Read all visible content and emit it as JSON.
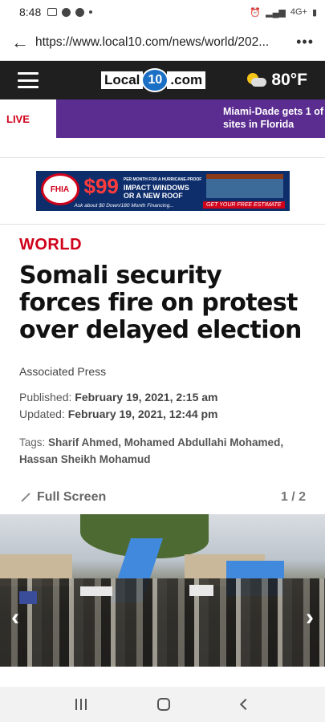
{
  "status_bar": {
    "time": "8:48",
    "network": "4G+"
  },
  "browser": {
    "url": "https://www.local10.com/news/world/202...",
    "menu_label": "•••"
  },
  "site_header": {
    "logo_left": "Local",
    "logo_num": "10",
    "logo_right": ".com",
    "temperature": "80°F"
  },
  "live_ticker": {
    "live_label": "LIVE",
    "line1": "Miami-Dade gets 1 of",
    "line2": "sites in Florida"
  },
  "ad": {
    "brand": "FHIA",
    "price": "$99",
    "line1": "PER MONTH FOR A HURRICANE-PROOF",
    "line2": "IMPACT WINDOWS",
    "line3": "OR A NEW ROOF",
    "ask": "Ask about $0 Down/180 Month Financing...",
    "cta": "GET YOUR FREE ESTIMATE"
  },
  "article": {
    "section": "WORLD",
    "headline": "Somali security forces fire on protest over delayed election",
    "byline": "Associated Press",
    "published_label": "Published:",
    "published_value": "February 19, 2021, 2:15 am",
    "updated_label": "Updated:",
    "updated_value": "February 19, 2021, 12:44 pm",
    "tags_label": "Tags:",
    "tags_value": "Sharif Ahmed, Mohamed Abdullahi Mohamed, Hassan Sheikh Mohamud"
  },
  "gallery": {
    "full_screen_label": "Full Screen",
    "counter": "1 / 2",
    "prev": "‹",
    "next": "›"
  },
  "colors": {
    "accent_red": "#d0021b",
    "ticker_purple": "#5c2d91",
    "header_dark": "#1f1f1f",
    "logo_blue": "#1b6fc4"
  }
}
